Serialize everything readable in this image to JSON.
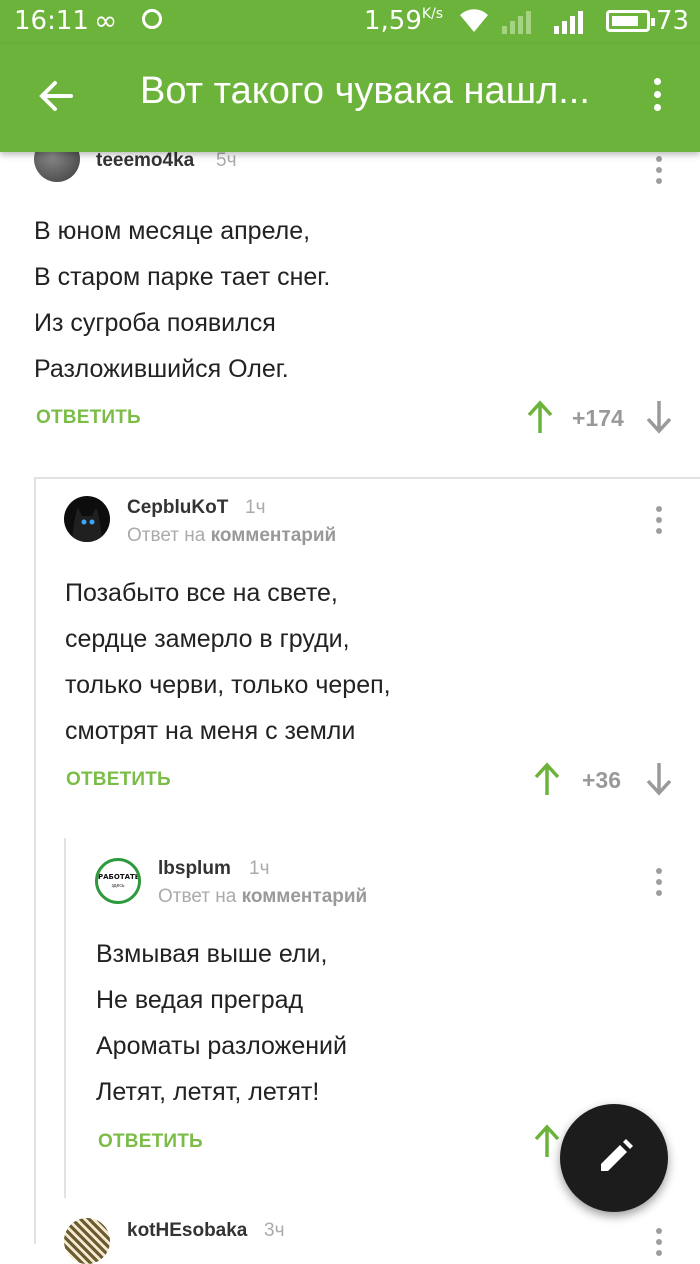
{
  "status_bar": {
    "time": "16:11",
    "speed_value": "1,59",
    "speed_unit": "K/s",
    "battery": "73",
    "icons": [
      "infinity-icon",
      "circle-notification-icon",
      "wifi-icon",
      "signal-icon",
      "battery-icon"
    ]
  },
  "app_bar": {
    "title": "Вот такого чувака нашл...",
    "back_icon": "arrow-back-icon",
    "menu_icon": "more-vert-icon"
  },
  "colors": {
    "accent": "#6bb33a",
    "reply_green": "#7bbd48",
    "fab": "#1c1c1c"
  },
  "comments": [
    {
      "user": "teeemo4ka",
      "time": "5ч",
      "lines": [
        "В юном месяце апреле,",
        "В старом парке тает снег.",
        "Из сугроба появился",
        "Разложившийся Олег."
      ],
      "reply_label": "ОТВЕТИТЬ",
      "score": "+174"
    },
    {
      "user": "CepbluKoT",
      "time": "1ч",
      "reply_prefix": "Ответ на",
      "reply_target": "комментарий",
      "lines": [
        "Позабыто все на свете,",
        "сердце замерло в груди,",
        "только черви, только череп,",
        "смотрят на меня с земли"
      ],
      "reply_label": "ОТВЕТИТЬ",
      "score": "+36"
    },
    {
      "user": "lbsplum",
      "time": "1ч",
      "avatar_text": "РАБОТАТЬ",
      "avatar_subtext": "здесь",
      "reply_prefix": "Ответ на",
      "reply_target": "комментарий",
      "lines": [
        "Взмывая выше ели,",
        "Не ведая преград",
        "Ароматы разложений",
        "Летят, летят, летят!"
      ],
      "reply_label": "ОТВЕТИТЬ"
    },
    {
      "user": "kotHEsobaka",
      "time": "3ч"
    }
  ],
  "fab": {
    "icon": "edit-pencil-icon"
  }
}
